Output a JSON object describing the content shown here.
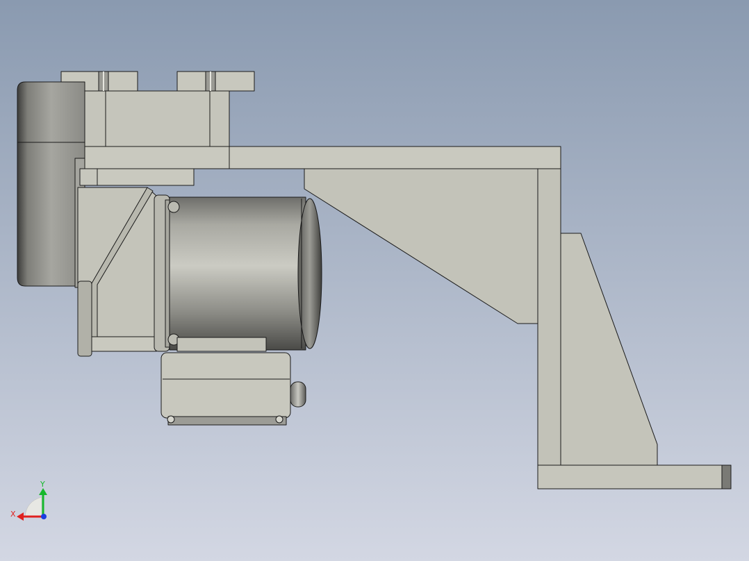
{
  "viewport": {
    "background_top": "#8a9ab0",
    "background_bottom": "#d3d7e3"
  },
  "colors": {
    "part_fill": "#c3c3b9",
    "part_fill_light": "#cfcfc6",
    "part_edge": "#1a1a1a",
    "axis_x": "#e0211f",
    "axis_y": "#16b82c",
    "axis_z": "#1b3ee0"
  },
  "triad": {
    "x_label": "X",
    "y_label": "Y"
  },
  "icons": {
    "triad": "coordinate-triad-icon"
  }
}
